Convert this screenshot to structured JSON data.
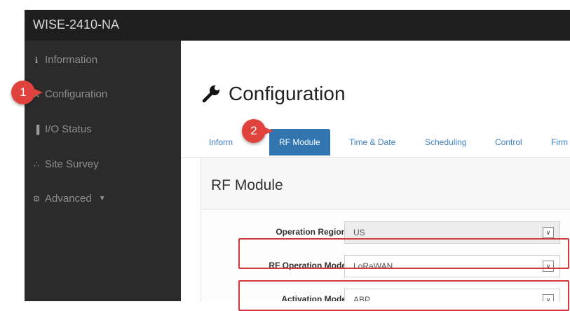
{
  "app": {
    "title": "WISE-2410-NA"
  },
  "sidebar": {
    "items": [
      {
        "label": "Information",
        "icon": "info-icon"
      },
      {
        "label": "Configuration",
        "icon": "wrench-icon"
      },
      {
        "label": "I/O Status",
        "icon": "bar-chart-icon"
      },
      {
        "label": "Site Survey",
        "icon": "sitemap-icon"
      },
      {
        "label": "Advanced",
        "icon": "gears-icon"
      }
    ]
  },
  "main": {
    "heading": "Configuration",
    "tabs": [
      {
        "label": "Inform"
      },
      {
        "label": "RF Module"
      },
      {
        "label": "Time & Date"
      },
      {
        "label": "Scheduling"
      },
      {
        "label": "Control"
      },
      {
        "label": "Firm"
      }
    ],
    "panel": {
      "title": "RF Module",
      "fields": [
        {
          "label": "Operation Region",
          "value": "US"
        },
        {
          "label": "RF Operation Mode",
          "value": "LoRaWAN"
        },
        {
          "label": "Activation Mode",
          "value": "ABP"
        }
      ]
    }
  },
  "annotations": {
    "step1": "1",
    "step2": "2"
  },
  "colors": {
    "accent": "#3276b1",
    "callout": "#e0433e",
    "sidebar": "#2b2b2b",
    "topbar": "#1e1e1e"
  }
}
